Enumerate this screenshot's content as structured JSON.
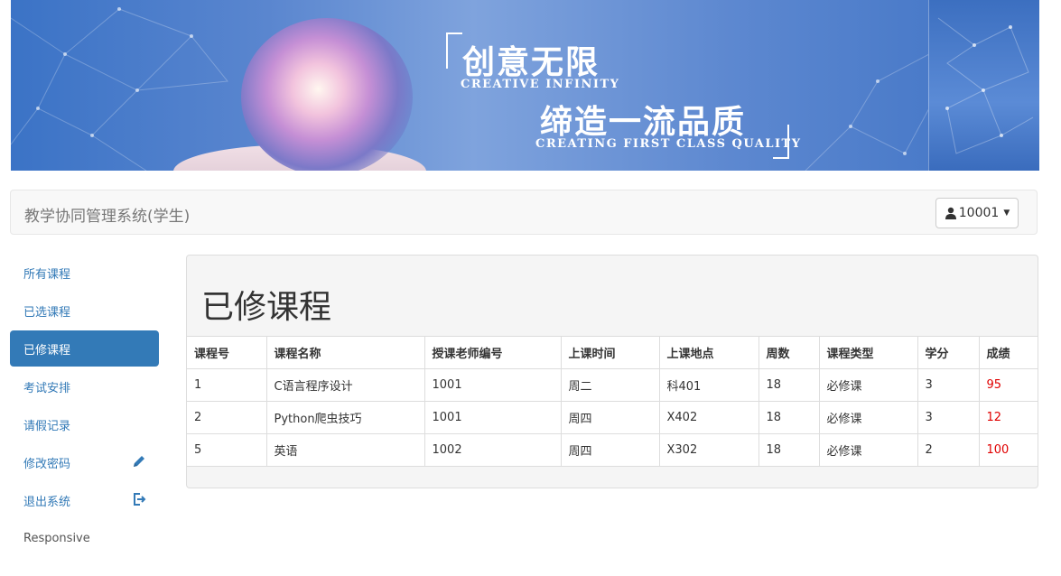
{
  "banner": {
    "title1": "创意无限",
    "title1_en": "CREATIVE INFINITY",
    "title2": "缔造一流品质",
    "title2_en": "CREATING FIRST CLASS QUALITY"
  },
  "navbar": {
    "brand": "教学协同管理系统(学生)",
    "user_icon": "user-icon",
    "user_id": "10001"
  },
  "sidebar": {
    "items": [
      {
        "label": "所有课程"
      },
      {
        "label": "已选课程"
      },
      {
        "label": "已修课程",
        "active": true
      },
      {
        "label": "考试安排"
      },
      {
        "label": "请假记录"
      },
      {
        "label": "修改密码",
        "icon": "pencil-icon"
      },
      {
        "label": "退出系统",
        "icon": "logout-icon"
      },
      {
        "label": "Responsive"
      }
    ]
  },
  "main": {
    "title": "已修课程",
    "columns": [
      "课程号",
      "课程名称",
      "授课老师编号",
      "上课时间",
      "上课地点",
      "周数",
      "课程类型",
      "学分",
      "成绩"
    ],
    "rows": [
      [
        "1",
        "C语言程序设计",
        "1001",
        "周二",
        "科401",
        "18",
        "必修课",
        "3",
        "95"
      ],
      [
        "2",
        "Python爬虫技巧",
        "1001",
        "周四",
        "X402",
        "18",
        "必修课",
        "3",
        "12"
      ],
      [
        "5",
        "英语",
        "1002",
        "周四",
        "X302",
        "18",
        "必修课",
        "2",
        "100"
      ]
    ]
  },
  "colors": {
    "accent": "#337ab7",
    "score": "#e00000",
    "banner": "#4d7fcc"
  }
}
